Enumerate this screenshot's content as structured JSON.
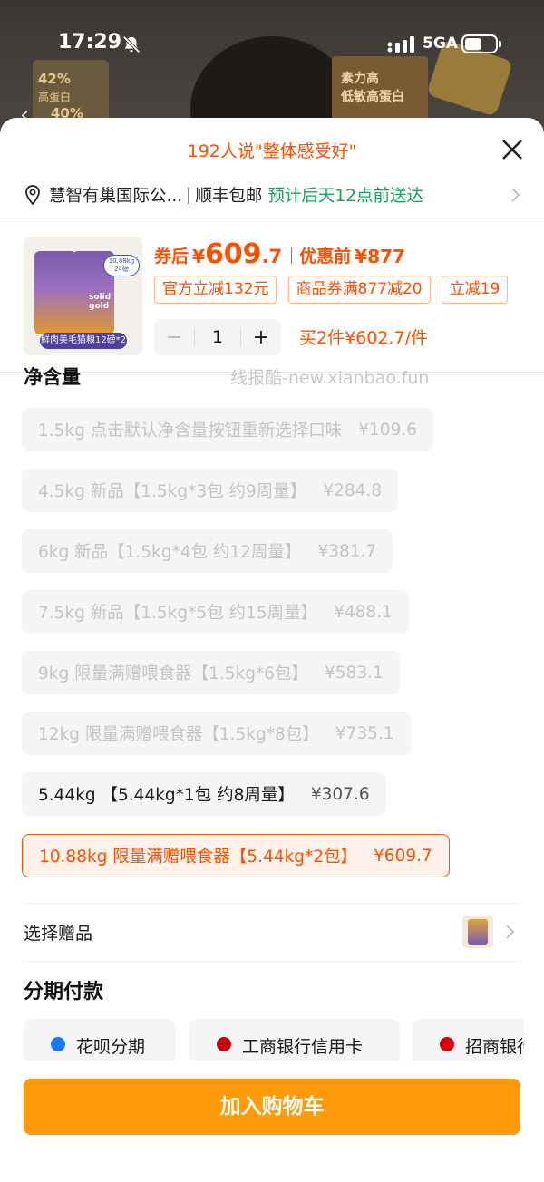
{
  "status_bar": {
    "time": "17:29",
    "network": "5GA",
    "battery_level": 0.55
  },
  "background": {
    "left_badge_pct": "42%",
    "left_badge_text": "高蛋白",
    "left_badge_pct2": "40%",
    "right_panel_line1": "素力高",
    "right_panel_line2": "低敏高蛋白"
  },
  "sheet": {
    "title": "192人说\"整体感受好\"",
    "address": "慧智有巢国际公...",
    "separator": "|",
    "shipping": "顺丰包邮",
    "eta": "预计后天12点前送达"
  },
  "product": {
    "image_brand": "solid gold",
    "image_badge": "10.88kg 24磅",
    "image_caption": "鲜肉美毛猫粮12磅*2",
    "coupon_price_label": "券后",
    "currency": "¥",
    "coupon_price_int": "609",
    "coupon_price_dec": ".7",
    "orig_price_label": "优惠前",
    "orig_price": "877",
    "tags": [
      "官方立减132元",
      "商品券满877减20",
      "立减19"
    ],
    "quantity": "1",
    "minus": "−",
    "plus": "+",
    "bulk_offer": "买2件¥602.7/件"
  },
  "watermark": "线报酷-new.xianbao.fun",
  "section_title": "净含量",
  "options": [
    {
      "label": "1.5kg 点击默认净含量按钮重新选择口味",
      "price": "¥109.6",
      "state": "disabled"
    },
    {
      "label": "4.5kg 新品【1.5kg*3包 约9周量】",
      "price": "¥284.8",
      "state": "disabled"
    },
    {
      "label": "6kg 新品【1.5kg*4包 约12周量】",
      "price": "¥381.7",
      "state": "disabled"
    },
    {
      "label": "7.5kg 新品【1.5kg*5包 约15周量】",
      "price": "¥488.1",
      "state": "disabled"
    },
    {
      "label": "9kg 限量满赠喂食器【1.5kg*6包】",
      "price": "¥583.1",
      "state": "disabled"
    },
    {
      "label": "12kg 限量满赠喂食器【1.5kg*8包】",
      "price": "¥735.1",
      "state": "disabled"
    },
    {
      "label": "5.44kg 【5.44kg*1包 约8周量】",
      "price": "¥307.6",
      "state": "normal"
    },
    {
      "label": "10.88kg 限量满赠喂食器【5.44kg*2包】",
      "price": "¥609.7",
      "state": "selected"
    }
  ],
  "gift": {
    "label": "选择赠品"
  },
  "installments": {
    "title": "分期付款",
    "cards": [
      {
        "label": "花呗分期",
        "icon_color": "#1677ff"
      },
      {
        "label": "工商银行信用卡",
        "icon_color": "#c7000b"
      },
      {
        "label": "招商银行",
        "icon_color": "#d7000f"
      }
    ]
  },
  "cart_button": "加入购物车",
  "colors": {
    "accent": "#ff5000",
    "green": "#1aa35c",
    "cart": "#ff9b0a"
  }
}
